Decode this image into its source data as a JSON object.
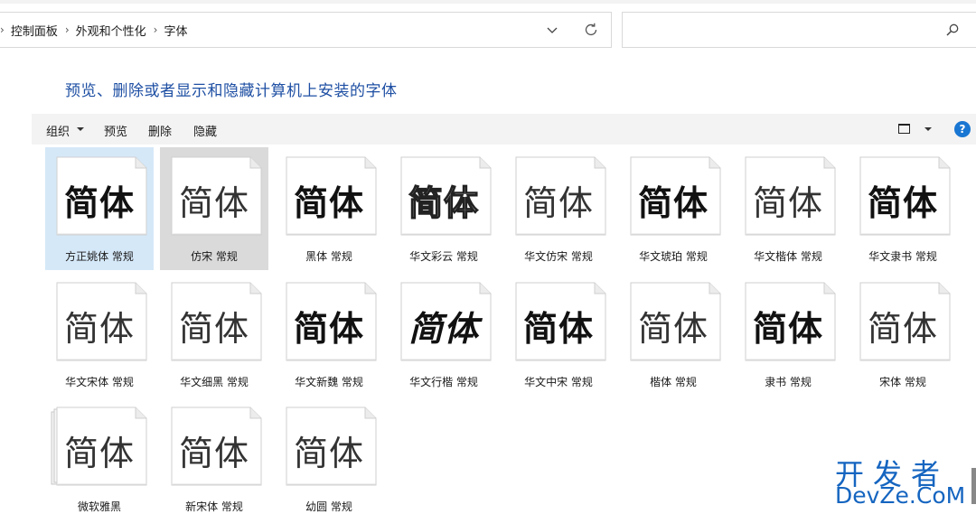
{
  "address": {
    "breadcrumbs": [
      "控制面板",
      "外观和个性化",
      "字体"
    ]
  },
  "search": {
    "placeholder": ""
  },
  "heading": "预览、删除或者显示和隐藏计算机上安装的字体",
  "toolbar": {
    "organize": "组织",
    "preview": "预览",
    "delete": "删除",
    "hide": "隐藏",
    "help": "?"
  },
  "fonts": [
    {
      "label": "方正姚体 常规",
      "sample": "简体",
      "selected": "blue"
    },
    {
      "label": "仿宋 常规",
      "sample": "简体",
      "selected": "gray"
    },
    {
      "label": "黑体 常规",
      "sample": "简体"
    },
    {
      "label": "华文彩云 常规",
      "sample": "简体"
    },
    {
      "label": "华文仿宋 常规",
      "sample": "简体"
    },
    {
      "label": "华文琥珀 常规",
      "sample": "简体"
    },
    {
      "label": "华文楷体 常规",
      "sample": "简体"
    },
    {
      "label": "华文隶书 常规",
      "sample": "简体"
    },
    {
      "label": "华文宋体 常规",
      "sample": "简体"
    },
    {
      "label": "华文细黑 常规",
      "sample": "简体"
    },
    {
      "label": "华文新魏 常规",
      "sample": "简体"
    },
    {
      "label": "华文行楷 常规",
      "sample": "简体"
    },
    {
      "label": "华文中宋 常规",
      "sample": "简体"
    },
    {
      "label": "楷体 常规",
      "sample": "简体"
    },
    {
      "label": "隶书 常规",
      "sample": "简体"
    },
    {
      "label": "宋体 常规",
      "sample": "简体"
    },
    {
      "label": "微软雅黑",
      "sample": "简体",
      "stacked": true
    },
    {
      "label": "新宋体 常规",
      "sample": "简体"
    },
    {
      "label": "幼圆 常规",
      "sample": "简体"
    }
  ],
  "watermark": {
    "cn": "开发者",
    "en": "DevZe.CoM"
  },
  "colors": {
    "heading": "#1e4fa3",
    "selection_blue": "#d5e8f8",
    "selection_gray": "#dadada",
    "help": "#1976d2",
    "watermark": "#1565c0"
  }
}
